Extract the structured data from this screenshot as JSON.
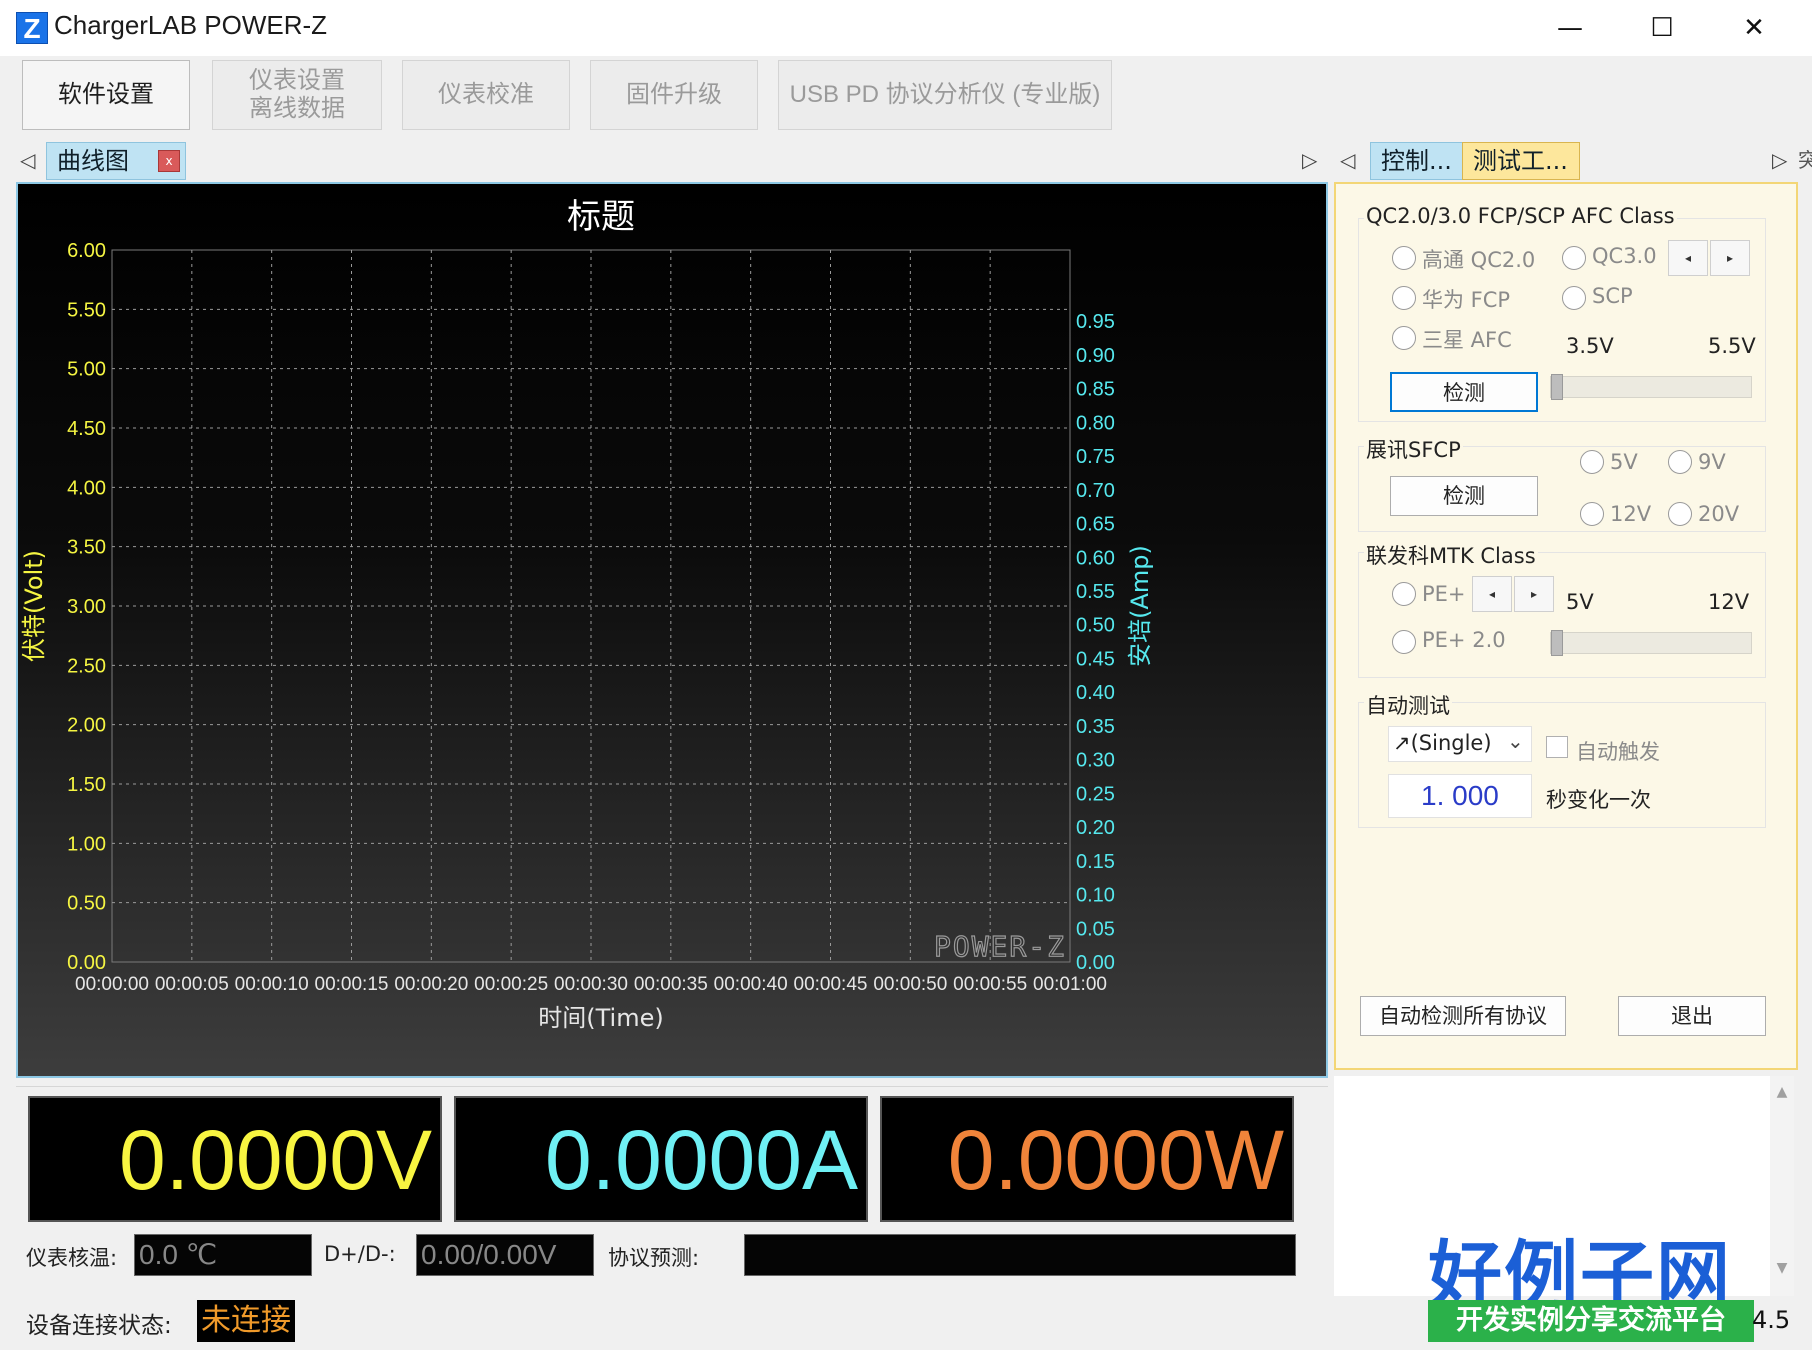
{
  "window": {
    "title": "ChargerLAB POWER-Z",
    "logo_letter": "Z",
    "minimize": "—",
    "maximize": "☐",
    "close": "✕"
  },
  "toolbar": {
    "software_settings": "软件设置",
    "meter_settings_line1": "仪表设置",
    "meter_settings_line2": "离线数据",
    "meter_calibration": "仪表校准",
    "firmware_upgrade": "固件升级",
    "usb_pd_analyzer": "USB PD 协议分析仪 (专业版)"
  },
  "left_tabs": {
    "arrow_left": "◁",
    "arrow_right": "▷",
    "curve_tab": "曲线图",
    "close": "x"
  },
  "right_tabs": {
    "arrow_left": "◁",
    "arrow_right": "▷",
    "control_tab": "控制...",
    "test_tab": "测试工...",
    "edge_glyph": "突"
  },
  "chart_data": {
    "type": "line",
    "title": "标题",
    "xlabel": "时间(Time)",
    "ylabel": "伏特(Volt)",
    "y2label": "安培(Amp)",
    "ylim": [
      0,
      6
    ],
    "y2lim": [
      0,
      0.95
    ],
    "grid": true,
    "x_ticks": [
      "00:00:00",
      "00:00:05",
      "00:00:10",
      "00:00:15",
      "00:00:20",
      "00:00:25",
      "00:00:30",
      "00:00:35",
      "00:00:40",
      "00:00:45",
      "00:00:50",
      "00:00:55",
      "00:01:00"
    ],
    "y_ticks": [
      "0.00",
      "0.50",
      "1.00",
      "1.50",
      "2.00",
      "2.50",
      "3.00",
      "3.50",
      "4.00",
      "4.50",
      "5.00",
      "5.50",
      "6.00"
    ],
    "y2_ticks": [
      "0.00",
      "0.05",
      "0.10",
      "0.15",
      "0.20",
      "0.25",
      "0.30",
      "0.35",
      "0.40",
      "0.45",
      "0.50",
      "0.55",
      "0.60",
      "0.65",
      "0.70",
      "0.75",
      "0.80",
      "0.85",
      "0.90",
      "0.95"
    ],
    "watermark": "POWER-Z",
    "colors": {
      "y_axis": "#f5f542",
      "y2_axis": "#56e8ee",
      "grid": "#9a9a9a"
    },
    "series": []
  },
  "readouts": {
    "voltage": "0.0000V",
    "current": "0.0000A",
    "power": "0.0000W",
    "voltage_color": "#f8f541",
    "current_color": "#6ff0f4",
    "power_color": "#f0843a"
  },
  "info": {
    "meter_temp_label": "仪表核温:",
    "meter_temp_value": "0.0 ℃",
    "dpdm_label": "D+/D-:",
    "dpdm_value": "0.00/0.00V",
    "protocol_predict_label": "协议预测:",
    "protocol_predict_value": ""
  },
  "status": {
    "label": "设备连接状态:",
    "value": "未连接"
  },
  "qc": {
    "title": "QC2.0/3.0 FCP/SCP AFC Class",
    "qc20": "高通 QC2.0",
    "qc30": "QC3.0",
    "fcp": "华为 FCP",
    "scp": "SCP",
    "afc": "三星 AFC",
    "v_min": "3.5V",
    "v_max": "5.5V",
    "detect": "检测",
    "spin_left": "◂",
    "spin_right": "▸",
    "slider_value": 0
  },
  "sfcp": {
    "title": "展讯SFCP",
    "detect": "检测",
    "v5": "5V",
    "v9": "9V",
    "v12": "12V",
    "v20": "20V"
  },
  "mtk": {
    "title": "联发科MTK Class",
    "pe_plus": "PE+",
    "pe_plus2": "PE+ 2.0",
    "v_min": "5V",
    "v_max": "12V",
    "spin_left": "◂",
    "spin_right": "▸",
    "slider_value": 0
  },
  "auto_test": {
    "title": "自动测试",
    "mode": "↗(Single)",
    "mode_arrow": "⌄",
    "auto_trigger": "自动触发",
    "interval": "1. 000",
    "interval_unit": "秒变化一次"
  },
  "bottom_buttons": {
    "auto_detect_all": "自动检测所有协议",
    "exit": "退出"
  },
  "log_scroll": {
    "up": "▲",
    "down": "▼"
  },
  "watermark": {
    "big": "好例子网",
    "small": "开发实例分享交流平台",
    "version": "4.5"
  }
}
